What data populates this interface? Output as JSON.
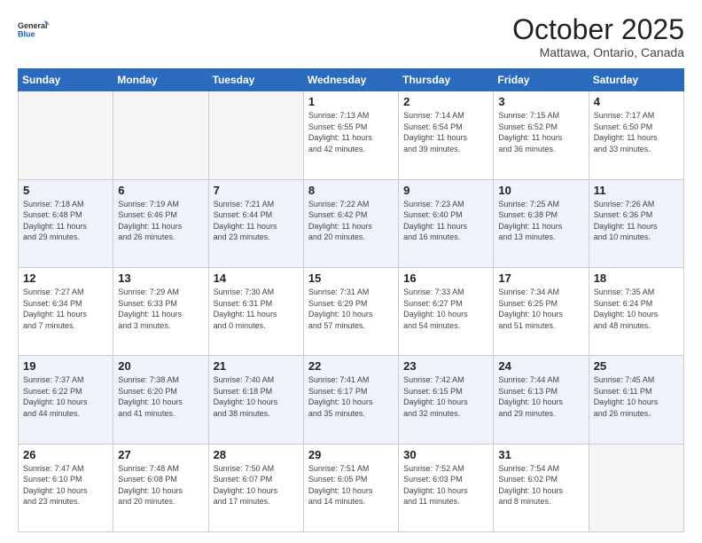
{
  "header": {
    "logo_line1": "General",
    "logo_line2": "Blue",
    "title": "October 2025",
    "subtitle": "Mattawa, Ontario, Canada"
  },
  "weekdays": [
    "Sunday",
    "Monday",
    "Tuesday",
    "Wednesday",
    "Thursday",
    "Friday",
    "Saturday"
  ],
  "weeks": [
    [
      {
        "day": "",
        "info": ""
      },
      {
        "day": "",
        "info": ""
      },
      {
        "day": "",
        "info": ""
      },
      {
        "day": "1",
        "info": "Sunrise: 7:13 AM\nSunset: 6:55 PM\nDaylight: 11 hours\nand 42 minutes."
      },
      {
        "day": "2",
        "info": "Sunrise: 7:14 AM\nSunset: 6:54 PM\nDaylight: 11 hours\nand 39 minutes."
      },
      {
        "day": "3",
        "info": "Sunrise: 7:15 AM\nSunset: 6:52 PM\nDaylight: 11 hours\nand 36 minutes."
      },
      {
        "day": "4",
        "info": "Sunrise: 7:17 AM\nSunset: 6:50 PM\nDaylight: 11 hours\nand 33 minutes."
      }
    ],
    [
      {
        "day": "5",
        "info": "Sunrise: 7:18 AM\nSunset: 6:48 PM\nDaylight: 11 hours\nand 29 minutes."
      },
      {
        "day": "6",
        "info": "Sunrise: 7:19 AM\nSunset: 6:46 PM\nDaylight: 11 hours\nand 26 minutes."
      },
      {
        "day": "7",
        "info": "Sunrise: 7:21 AM\nSunset: 6:44 PM\nDaylight: 11 hours\nand 23 minutes."
      },
      {
        "day": "8",
        "info": "Sunrise: 7:22 AM\nSunset: 6:42 PM\nDaylight: 11 hours\nand 20 minutes."
      },
      {
        "day": "9",
        "info": "Sunrise: 7:23 AM\nSunset: 6:40 PM\nDaylight: 11 hours\nand 16 minutes."
      },
      {
        "day": "10",
        "info": "Sunrise: 7:25 AM\nSunset: 6:38 PM\nDaylight: 11 hours\nand 13 minutes."
      },
      {
        "day": "11",
        "info": "Sunrise: 7:26 AM\nSunset: 6:36 PM\nDaylight: 11 hours\nand 10 minutes."
      }
    ],
    [
      {
        "day": "12",
        "info": "Sunrise: 7:27 AM\nSunset: 6:34 PM\nDaylight: 11 hours\nand 7 minutes."
      },
      {
        "day": "13",
        "info": "Sunrise: 7:29 AM\nSunset: 6:33 PM\nDaylight: 11 hours\nand 3 minutes."
      },
      {
        "day": "14",
        "info": "Sunrise: 7:30 AM\nSunset: 6:31 PM\nDaylight: 11 hours\nand 0 minutes."
      },
      {
        "day": "15",
        "info": "Sunrise: 7:31 AM\nSunset: 6:29 PM\nDaylight: 10 hours\nand 57 minutes."
      },
      {
        "day": "16",
        "info": "Sunrise: 7:33 AM\nSunset: 6:27 PM\nDaylight: 10 hours\nand 54 minutes."
      },
      {
        "day": "17",
        "info": "Sunrise: 7:34 AM\nSunset: 6:25 PM\nDaylight: 10 hours\nand 51 minutes."
      },
      {
        "day": "18",
        "info": "Sunrise: 7:35 AM\nSunset: 6:24 PM\nDaylight: 10 hours\nand 48 minutes."
      }
    ],
    [
      {
        "day": "19",
        "info": "Sunrise: 7:37 AM\nSunset: 6:22 PM\nDaylight: 10 hours\nand 44 minutes."
      },
      {
        "day": "20",
        "info": "Sunrise: 7:38 AM\nSunset: 6:20 PM\nDaylight: 10 hours\nand 41 minutes."
      },
      {
        "day": "21",
        "info": "Sunrise: 7:40 AM\nSunset: 6:18 PM\nDaylight: 10 hours\nand 38 minutes."
      },
      {
        "day": "22",
        "info": "Sunrise: 7:41 AM\nSunset: 6:17 PM\nDaylight: 10 hours\nand 35 minutes."
      },
      {
        "day": "23",
        "info": "Sunrise: 7:42 AM\nSunset: 6:15 PM\nDaylight: 10 hours\nand 32 minutes."
      },
      {
        "day": "24",
        "info": "Sunrise: 7:44 AM\nSunset: 6:13 PM\nDaylight: 10 hours\nand 29 minutes."
      },
      {
        "day": "25",
        "info": "Sunrise: 7:45 AM\nSunset: 6:11 PM\nDaylight: 10 hours\nand 26 minutes."
      }
    ],
    [
      {
        "day": "26",
        "info": "Sunrise: 7:47 AM\nSunset: 6:10 PM\nDaylight: 10 hours\nand 23 minutes."
      },
      {
        "day": "27",
        "info": "Sunrise: 7:48 AM\nSunset: 6:08 PM\nDaylight: 10 hours\nand 20 minutes."
      },
      {
        "day": "28",
        "info": "Sunrise: 7:50 AM\nSunset: 6:07 PM\nDaylight: 10 hours\nand 17 minutes."
      },
      {
        "day": "29",
        "info": "Sunrise: 7:51 AM\nSunset: 6:05 PM\nDaylight: 10 hours\nand 14 minutes."
      },
      {
        "day": "30",
        "info": "Sunrise: 7:52 AM\nSunset: 6:03 PM\nDaylight: 10 hours\nand 11 minutes."
      },
      {
        "day": "31",
        "info": "Sunrise: 7:54 AM\nSunset: 6:02 PM\nDaylight: 10 hours\nand 8 minutes."
      },
      {
        "day": "",
        "info": ""
      }
    ]
  ]
}
